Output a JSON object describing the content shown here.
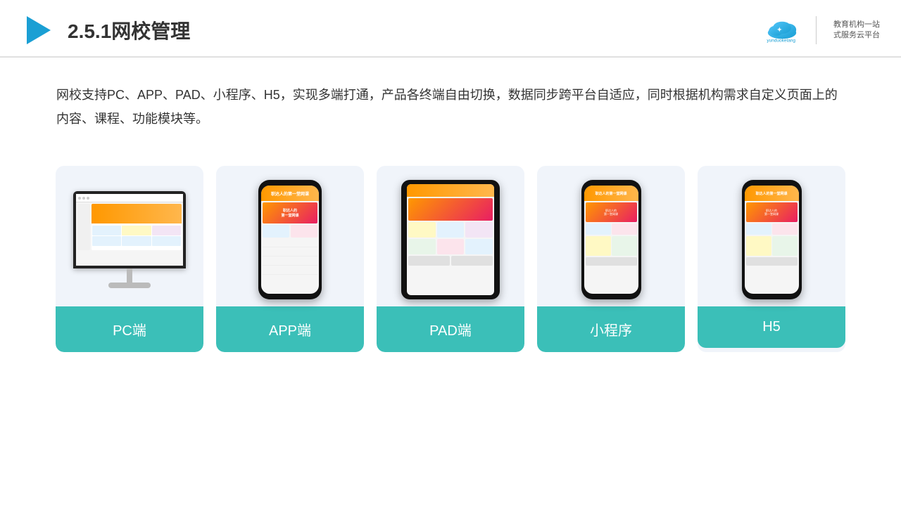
{
  "header": {
    "title": "2.5.1网校管理",
    "brand_name": "云朵课堂",
    "brand_url": "yunduoketang.com",
    "brand_slogan_line1": "教育机构一站",
    "brand_slogan_line2": "式服务云平台"
  },
  "description": {
    "text": "网校支持PC、APP、PAD、小程序、H5，实现多端打通，产品各终端自由切换，数据同步跨平台自适应，同时根据机构需求自定义页面上的内容、课程、功能模块等。"
  },
  "cards": [
    {
      "id": "pc",
      "label": "PC端",
      "type": "monitor"
    },
    {
      "id": "app",
      "label": "APP端",
      "type": "phone"
    },
    {
      "id": "pad",
      "label": "PAD端",
      "type": "tablet"
    },
    {
      "id": "miniprogram",
      "label": "小程序",
      "type": "small-phone"
    },
    {
      "id": "h5",
      "label": "H5",
      "type": "small-phone"
    }
  ],
  "colors": {
    "accent": "#3bbfb8",
    "title_color": "#333333",
    "text_color": "#333333",
    "card_bg": "#eef2f8"
  }
}
